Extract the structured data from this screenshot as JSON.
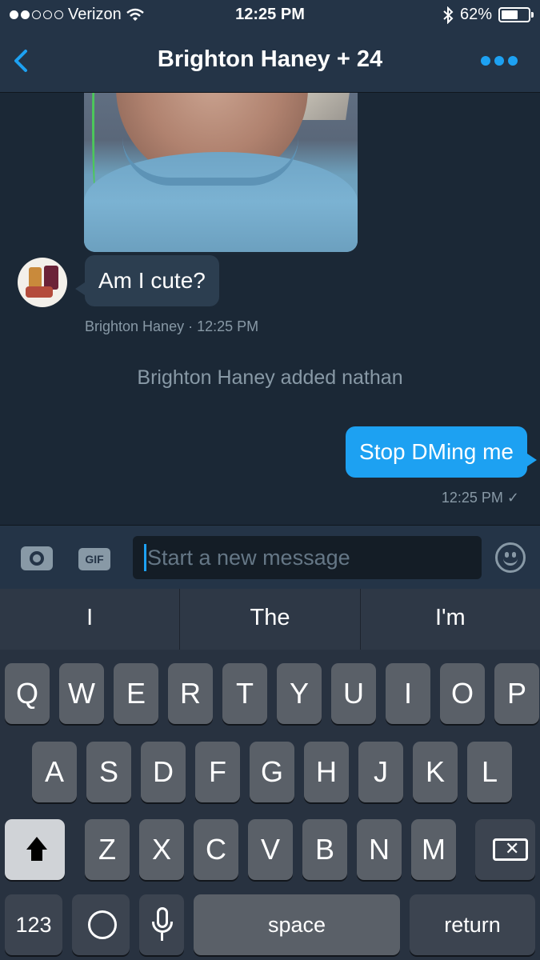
{
  "status_bar": {
    "signal_dots_filled": 2,
    "signal_dots_total": 5,
    "carrier": "Verizon",
    "time": "12:25 PM",
    "battery_percent": "62%",
    "battery_level": 0.62
  },
  "nav": {
    "title": "Brighton Haney + 24"
  },
  "messages": {
    "incoming_text": "Am I cute?",
    "incoming_meta": "Brighton Haney · 12:25 PM",
    "system_note": "Brighton Haney added nathan",
    "outgoing_text": "Stop DMing me",
    "outgoing_meta": "12:25 PM ✓"
  },
  "compose": {
    "gif_label": "GIF",
    "placeholder": "Start a new message"
  },
  "keyboard": {
    "suggestions": [
      "I",
      "The",
      "I'm"
    ],
    "row1": [
      "Q",
      "W",
      "E",
      "R",
      "T",
      "Y",
      "U",
      "I",
      "O",
      "P"
    ],
    "row2": [
      "A",
      "S",
      "D",
      "F",
      "G",
      "H",
      "J",
      "K",
      "L"
    ],
    "row3": [
      "Z",
      "X",
      "C",
      "V",
      "B",
      "N",
      "M"
    ],
    "numbers_label": "123",
    "space_label": "space",
    "return_label": "return"
  },
  "colors": {
    "background": "#1b2836",
    "header": "#243447",
    "accent": "#1da1f2",
    "secondary_text": "#8899a6"
  }
}
